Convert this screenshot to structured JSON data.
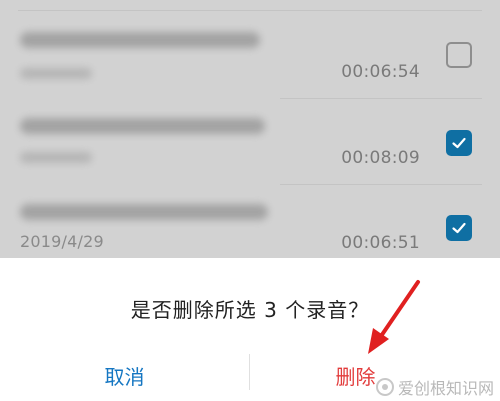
{
  "recordings": [
    {
      "date": "",
      "duration": "00:06:54",
      "checked": false
    },
    {
      "date": "",
      "duration": "00:08:09",
      "checked": true
    },
    {
      "date": "2019/4/29",
      "duration": "00:06:51",
      "checked": true
    }
  ],
  "dialog": {
    "message": "是否删除所选 3 个录音？",
    "cancel_label": "取消",
    "delete_label": "删除"
  },
  "watermark": {
    "text": "爱创根知识网"
  },
  "colors": {
    "dim_overlay": "#d2d2d2",
    "checkbox_checked": "#0f6fa3",
    "cancel_text": "#1476c2",
    "delete_text": "#e23b3b",
    "annotation_arrow": "#e02020"
  },
  "icons": {
    "checkbox_checked": "checkmark-icon",
    "annotation": "red-arrow-icon",
    "watermark_logo": "watermark-logo-icon"
  }
}
